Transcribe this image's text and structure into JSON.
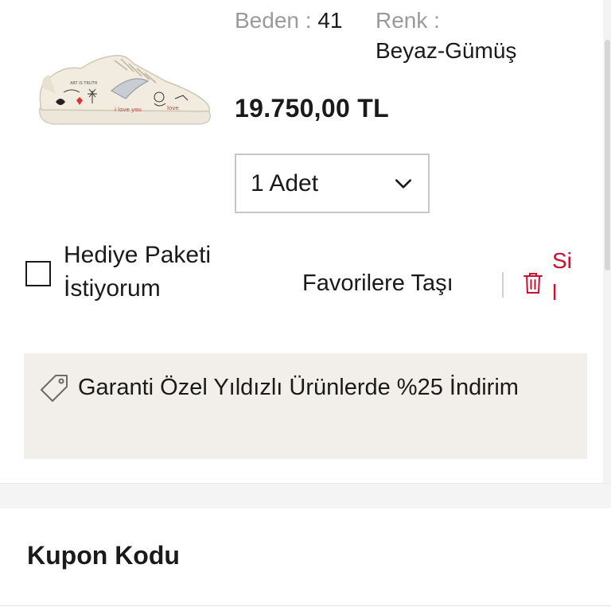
{
  "product": {
    "image_icon": "white-sneaker-with-doodles",
    "size_label": "Beden :",
    "size_value": "41",
    "color_label": "Renk :",
    "color_value": "Beyaz-Gümüş",
    "price": "19.750,00 TL"
  },
  "quantity": {
    "selected": "1 Adet",
    "icon": "chevron-down-icon"
  },
  "actions": {
    "gift_label": "Hediye Paketi İstiyorum",
    "gift_checked": false,
    "favorite_label": "Favorilere Taşı",
    "delete_label": "Sil",
    "delete_color": "#c8102e"
  },
  "promo": {
    "icon": "tag-icon",
    "text": "Garanti Özel Yıldızlı Ürünlerde %25 İndirim"
  },
  "coupon": {
    "title": "Kupon Kodu"
  }
}
